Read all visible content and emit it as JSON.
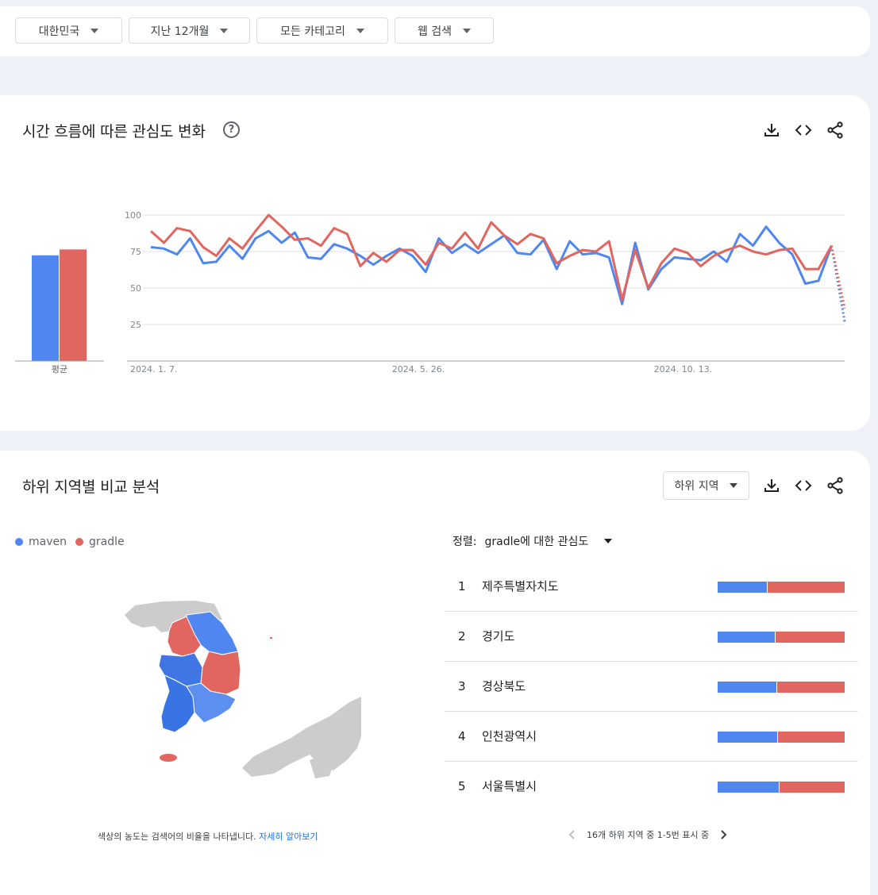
{
  "filters": [
    {
      "label": "대한민국"
    },
    {
      "label": "지난 12개월"
    },
    {
      "label": "모든 카테고리"
    },
    {
      "label": "웹 검색"
    }
  ],
  "time_card": {
    "title": "시간 흐름에 따른 관심도 변화",
    "help_glyph": "?",
    "avg_label": "평균"
  },
  "region_card": {
    "title": "하위 지역별 비교 분석",
    "subregion_label": "하위 지역",
    "sort_label": "정렬:",
    "sort_value": "gradle에 대한 관심도",
    "footnote_text": "색상의 농도는 검색어의 비율을 나타냅니다.",
    "footnote_link": "자세히 알아보기",
    "pager_text": "16개 하위 지역 중 1-5번 표시 중",
    "rows": [
      {
        "rank": "1",
        "name": "제주특별자치도",
        "maven_share": 0.39
      },
      {
        "rank": "2",
        "name": "경기도",
        "maven_share": 0.45
      },
      {
        "rank": "3",
        "name": "경상북도",
        "maven_share": 0.46
      },
      {
        "rank": "4",
        "name": "인천광역시",
        "maven_share": 0.47
      },
      {
        "rank": "5",
        "name": "서울특별시",
        "maven_share": 0.48
      }
    ]
  },
  "colors": {
    "maven": "#4f86f0",
    "gradle": "#e0665f"
  },
  "icons": [
    "download-icon",
    "embed-code-icon",
    "share-icon",
    "chevron-left-icon",
    "chevron-right-icon",
    "caret-down-icon"
  ],
  "chart_data": {
    "type": "line",
    "ylim": [
      0,
      100
    ],
    "yticks": [
      25,
      50,
      75,
      100
    ],
    "x_tick_labels": [
      {
        "index": 0,
        "label": "2024. 1. 7."
      },
      {
        "index": 20,
        "label": "2024. 5. 26."
      },
      {
        "index": 40,
        "label": "2024. 10. 13."
      }
    ],
    "legend": [
      {
        "name": "maven"
      },
      {
        "name": "gradle"
      }
    ],
    "averages": {
      "maven": 72,
      "gradle": 76
    },
    "series": [
      {
        "name": "maven",
        "values": [
          78,
          77,
          73,
          84,
          67,
          68,
          79,
          70,
          84,
          89,
          81,
          88,
          71,
          70,
          80,
          77,
          72,
          66,
          72,
          77,
          72,
          61,
          84,
          74,
          80,
          74,
          80,
          86,
          74,
          73,
          83,
          63,
          82,
          73,
          74,
          71,
          39,
          81,
          49,
          63,
          71,
          70,
          69,
          75,
          68,
          87,
          79,
          92,
          81,
          73,
          53,
          55,
          79,
          27
        ],
        "partial_from": 52
      },
      {
        "name": "gradle",
        "values": [
          89,
          81,
          91,
          89,
          78,
          72,
          84,
          77,
          89,
          100,
          92,
          83,
          84,
          79,
          91,
          87,
          65,
          74,
          68,
          76,
          76,
          66,
          81,
          77,
          88,
          77,
          95,
          86,
          80,
          87,
          84,
          67,
          72,
          76,
          75,
          82,
          42,
          76,
          50,
          67,
          77,
          74,
          65,
          72,
          76,
          79,
          75,
          73,
          76,
          77,
          63,
          63,
          79,
          36
        ],
        "partial_from": 52
      }
    ]
  }
}
